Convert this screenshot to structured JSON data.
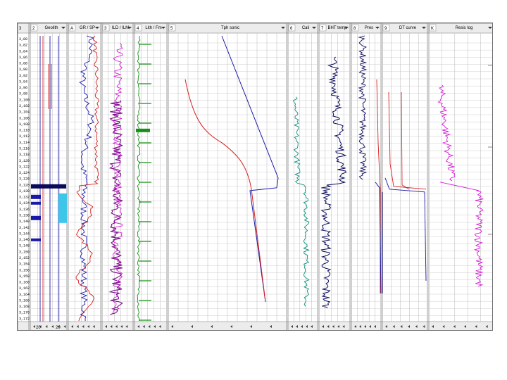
{
  "chart_data": {
    "type": "line",
    "depth_ticks": [
      "3,80",
      "3,82",
      "3,84",
      "3,86",
      "3,88",
      "3,90",
      "3,92",
      "3,94",
      "3,96",
      "3,98",
      "3,100",
      "3,102",
      "3,104",
      "3,106",
      "3,108",
      "3,110",
      "3,112",
      "3,114",
      "3,116",
      "3,118",
      "3,120",
      "3,122",
      "3,124",
      "3,126",
      "3,128",
      "3,130",
      "3,132",
      "3,134",
      "3,136",
      "3,138",
      "3,140",
      "3,142",
      "3,144",
      "3,146",
      "3,148",
      "3,150",
      "3,152",
      "3,154",
      "3,156",
      "3,158",
      "3,160",
      "3,162",
      "3,164",
      "3,166",
      "3,168",
      "3,170",
      "3,172"
    ],
    "tracks": [
      {
        "num": "2",
        "title": "Geolith",
        "footer": [
          "20",
          "20"
        ]
      },
      {
        "num": "A",
        "title": "GR / SP",
        "footer": []
      },
      {
        "num": "3",
        "title": "ILD / ILM",
        "footer": []
      },
      {
        "num": "4",
        "title": "Lith / Fm",
        "footer": []
      },
      {
        "num": "5",
        "title": "Tph sonic",
        "footer": []
      },
      {
        "num": "6",
        "title": "Cali",
        "footer": []
      },
      {
        "num": "7",
        "title": "BHT temp",
        "footer": []
      },
      {
        "num": "8",
        "title": "Pres",
        "footer": []
      },
      {
        "num": "9",
        "title": "DT curve",
        "footer": []
      },
      {
        "num": "K",
        "title": "Resis log",
        "footer": []
      }
    ],
    "formation_top_depth": 3128,
    "colors": {
      "blue": "#1a1aa8",
      "red": "#d42020",
      "magenta": "#d81ed8",
      "purple": "#7a108a",
      "green": "#169016",
      "teal": "#109080",
      "cyan": "#3cc6ea",
      "dark": "#0b0b5c"
    }
  }
}
